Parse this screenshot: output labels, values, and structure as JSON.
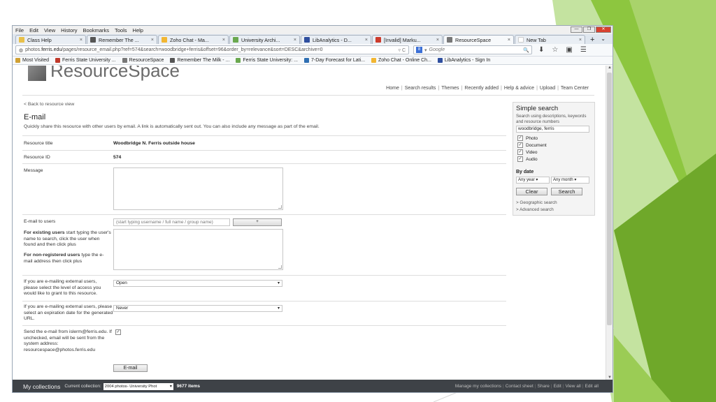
{
  "colors": {
    "accent_green": "#8dc63f",
    "dark_green": "#5a8f1f",
    "collection_bar": "#3e4247"
  },
  "menu": [
    "File",
    "Edit",
    "View",
    "History",
    "Bookmarks",
    "Tools",
    "Help"
  ],
  "window_controls": {
    "minimize": "—",
    "restore": "❐",
    "close": "✕"
  },
  "tabs": [
    {
      "label": "Class Help",
      "icon_color": "#e8c04a",
      "active": false
    },
    {
      "label": "Remember The ...",
      "icon_color": "#555555",
      "active": false
    },
    {
      "label": "Zoho Chat - Ma...",
      "icon_color": "#f2b632",
      "active": false
    },
    {
      "label": "University Archi...",
      "icon_color": "#6aa84f",
      "active": false
    },
    {
      "label": "LibAnalytics - D...",
      "icon_color": "#2f4f9f",
      "active": false
    },
    {
      "label": "[Invalid] Marku...",
      "icon_color": "#cc3b2b",
      "active": false
    },
    {
      "label": "ResourceSpace",
      "icon_color": "#777777",
      "active": true
    },
    {
      "label": "New Tab",
      "icon_color": "#ffffff",
      "active": false
    }
  ],
  "tab_close": "×",
  "tab_new": "+",
  "tab_list": "⌄",
  "url": {
    "prefix": "photos.",
    "host": "ferris.edu",
    "path": "/pages/resource_email.php?ref=574&search=woodbridge+ferris&offset=96&order_by=relevance&sort=DESC&archive=0",
    "controls": "▿ C"
  },
  "search_engine": {
    "icon": "8",
    "placeholder": "Google",
    "arrow": "▾",
    "submit": "🔍"
  },
  "nav_icons": {
    "download": "⬇",
    "star": "☆",
    "library": "▣",
    "menu": "☰"
  },
  "bookmarks": [
    {
      "label": "Most Visited",
      "icon_color": "#d0a033"
    },
    {
      "label": "Ferris State University ...",
      "icon_color": "#c0392b"
    },
    {
      "label": "ResourceSpace",
      "icon_color": "#777777"
    },
    {
      "label": "Remember The Milk - ...",
      "icon_color": "#555555"
    },
    {
      "label": "Ferris State University: ...",
      "icon_color": "#6aa84f"
    },
    {
      "label": "7-Day Forecast for Lati...",
      "icon_color": "#2f6fb3"
    },
    {
      "label": "Zoho Chat - Online Ch...",
      "icon_color": "#f2b632"
    },
    {
      "label": "LibAnalytics - Sign In",
      "icon_color": "#2f4f9f"
    }
  ],
  "site": {
    "logo": "ResourceSpace",
    "top_nav": [
      "Home",
      "Search results",
      "Themes",
      "Recently added",
      "Help & advice",
      "Upload",
      "Team Center"
    ],
    "nav_sep": "|"
  },
  "page": {
    "back_link": "< Back to resource view",
    "title": "E-mail",
    "intro": "Quickly share this resource with other users by email. A link is automatically sent out. You can also include any message as part of the email.",
    "resource_title_label": "Resource title",
    "resource_title_value": "Woodbridge N. Ferris outside house",
    "resource_id_label": "Resource ID",
    "resource_id_value": "574",
    "message_label": "Message",
    "email_users_label": "E-mail to users",
    "email_users_placeholder": "(start typing username / full name / group name)",
    "plus_button": "+",
    "existing_users_bold": "For existing users",
    "existing_users_text": " start typing the user's name to search, click the user when found and then click plus",
    "nonreg_bold": "For non-registered users",
    "nonreg_text": " type the e-mail address then click plus",
    "access_label": "If you are e-mailing external users, please select the level of access you would like to grant to this resource.",
    "access_value": "Open",
    "expiry_label": "If you are e-mailing external users, please select an expiration date for the generated URL.",
    "expiry_value": "Never",
    "sendfrom_label": "Send the e-mail from islerm@ferris.edu. If unchecked, email will be sent from the system address: resourcespace@photos.ferris.edu",
    "sendfrom_checked": "✓",
    "email_button": "E-mail"
  },
  "simple_search": {
    "title": "Simple search",
    "desc": "Search using descriptions, keywords and resource numbers",
    "query": "woodbridge, ferris",
    "types": [
      {
        "label": "Photo",
        "checked": "✓"
      },
      {
        "label": "Document",
        "checked": "✓"
      },
      {
        "label": "Video",
        "checked": "✓"
      },
      {
        "label": "Audio",
        "checked": "✓"
      }
    ],
    "by_date": "By date",
    "any_year": "Any year",
    "any_month": "Any month",
    "clear": "Clear",
    "search": "Search",
    "geo_link": "> Geographic search",
    "adv_link": "> Advanced search"
  },
  "collections": {
    "title": "My collections",
    "current_label": "Current collection:",
    "current_value": "2004 photos- University Phot",
    "count": "9677 items",
    "links": [
      "Manage my collections",
      "Contact sheet",
      "Share",
      "Edit",
      "View all",
      "Edit all"
    ]
  }
}
